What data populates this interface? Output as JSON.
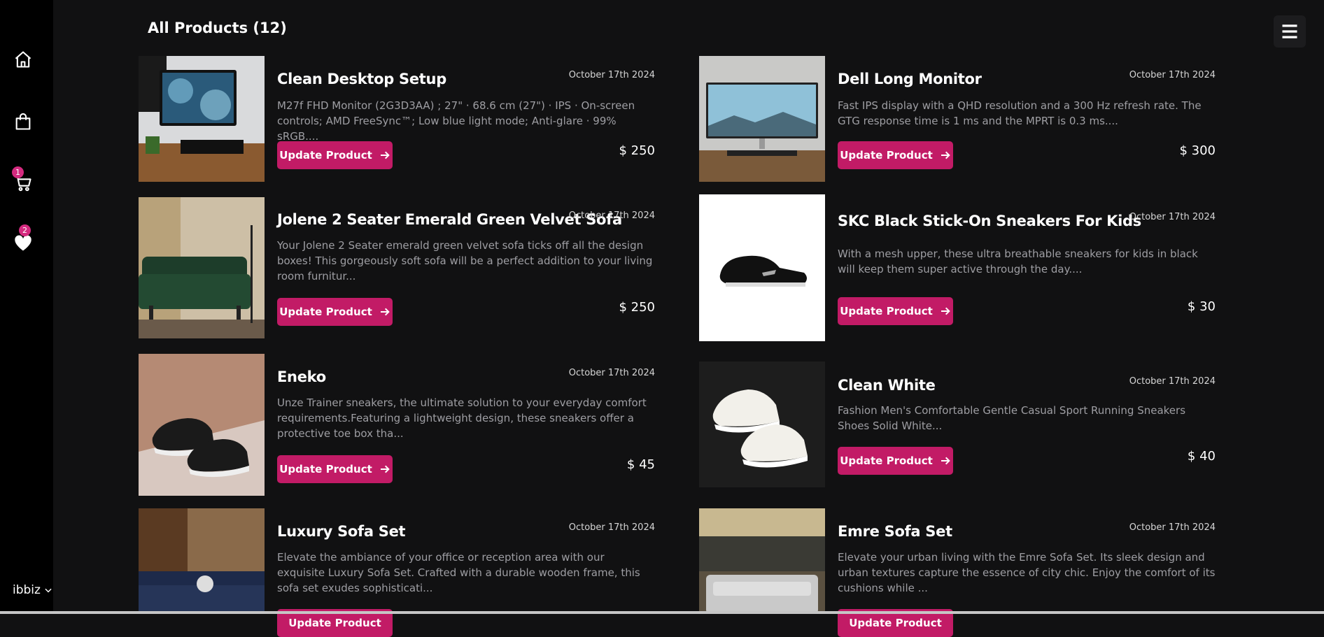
{
  "page": {
    "title": "All Products (12)"
  },
  "sidebar": {
    "items": [
      {
        "name": "home",
        "icon": "home-icon"
      },
      {
        "name": "bag",
        "icon": "shopping-bag-icon"
      },
      {
        "name": "cart",
        "icon": "cart-icon",
        "badge": "1"
      },
      {
        "name": "wishlist",
        "icon": "heart-icon",
        "badge": "2"
      }
    ],
    "user": {
      "label": "ibbiz",
      "icon": "chevron-down-icon"
    }
  },
  "header": {
    "menu_icon": "hamburger-menu-icon"
  },
  "accent_color": "#c21b66",
  "badge_color": "#d42a7f",
  "button": {
    "label": "Update Product",
    "icon": "arrow-right-icon"
  },
  "products": [
    {
      "name": "Clean Desktop Setup",
      "date": "October 17th 2024",
      "description": "M27f FHD Monitor (2G3D3AA) ; 27\" · 68.6 cm (27\") · IPS · On-screen controls; AMD FreeSync™; Low blue light mode; Anti-glare · 99% sRGB....",
      "price": "$ 250"
    },
    {
      "name": "Dell Long Monitor",
      "date": "October 17th 2024",
      "description": "Fast IPS display with a QHD resolution and a 300 Hz refresh rate. The GTG response time is 1 ms and the MPRT is 0.3 ms....",
      "price": "$ 300"
    },
    {
      "name": "Jolene 2 Seater Emerald Green Velvet Sofa",
      "date": "October 17th 2024",
      "description": "Your Jolene 2 Seater emerald green velvet sofa ticks off all the design boxes! This gorgeously soft sofa will be a perfect addition to your living room furnitur...",
      "price": "$ 250"
    },
    {
      "name": "SKC Black Stick-On Sneakers For Kids",
      "date": "October 17th 2024",
      "description": "With a mesh upper, these ultra breathable sneakers for kids in black will keep them super active through the day....",
      "price": "$ 30"
    },
    {
      "name": "Eneko",
      "date": "October 17th 2024",
      "description": "Unze Trainer sneakers, the ultimate solution to your everyday comfort requirements.Featuring a lightweight design, these sneakers offer a protective toe box tha...",
      "price": "$ 45"
    },
    {
      "name": "Clean White",
      "date": "October 17th 2024",
      "description": "Fashion Men's Comfortable Gentle Casual Sport Running Sneakers Shoes Solid White...",
      "price": "$ 40"
    },
    {
      "name": "Luxury Sofa Set",
      "date": "October 17th 2024",
      "description": "Elevate the ambiance of your office or reception area with our exquisite Luxury Sofa Set. Crafted with a durable wooden frame, this sofa set exudes sophisticati...",
      "price": ""
    },
    {
      "name": "Emre Sofa Set",
      "date": "October 17th 2024",
      "description": "Elevate your urban living with the Emre Sofa Set. Its sleek design and urban textures capture the essence of city chic. Enjoy the comfort of its cushions while ...",
      "price": ""
    }
  ]
}
